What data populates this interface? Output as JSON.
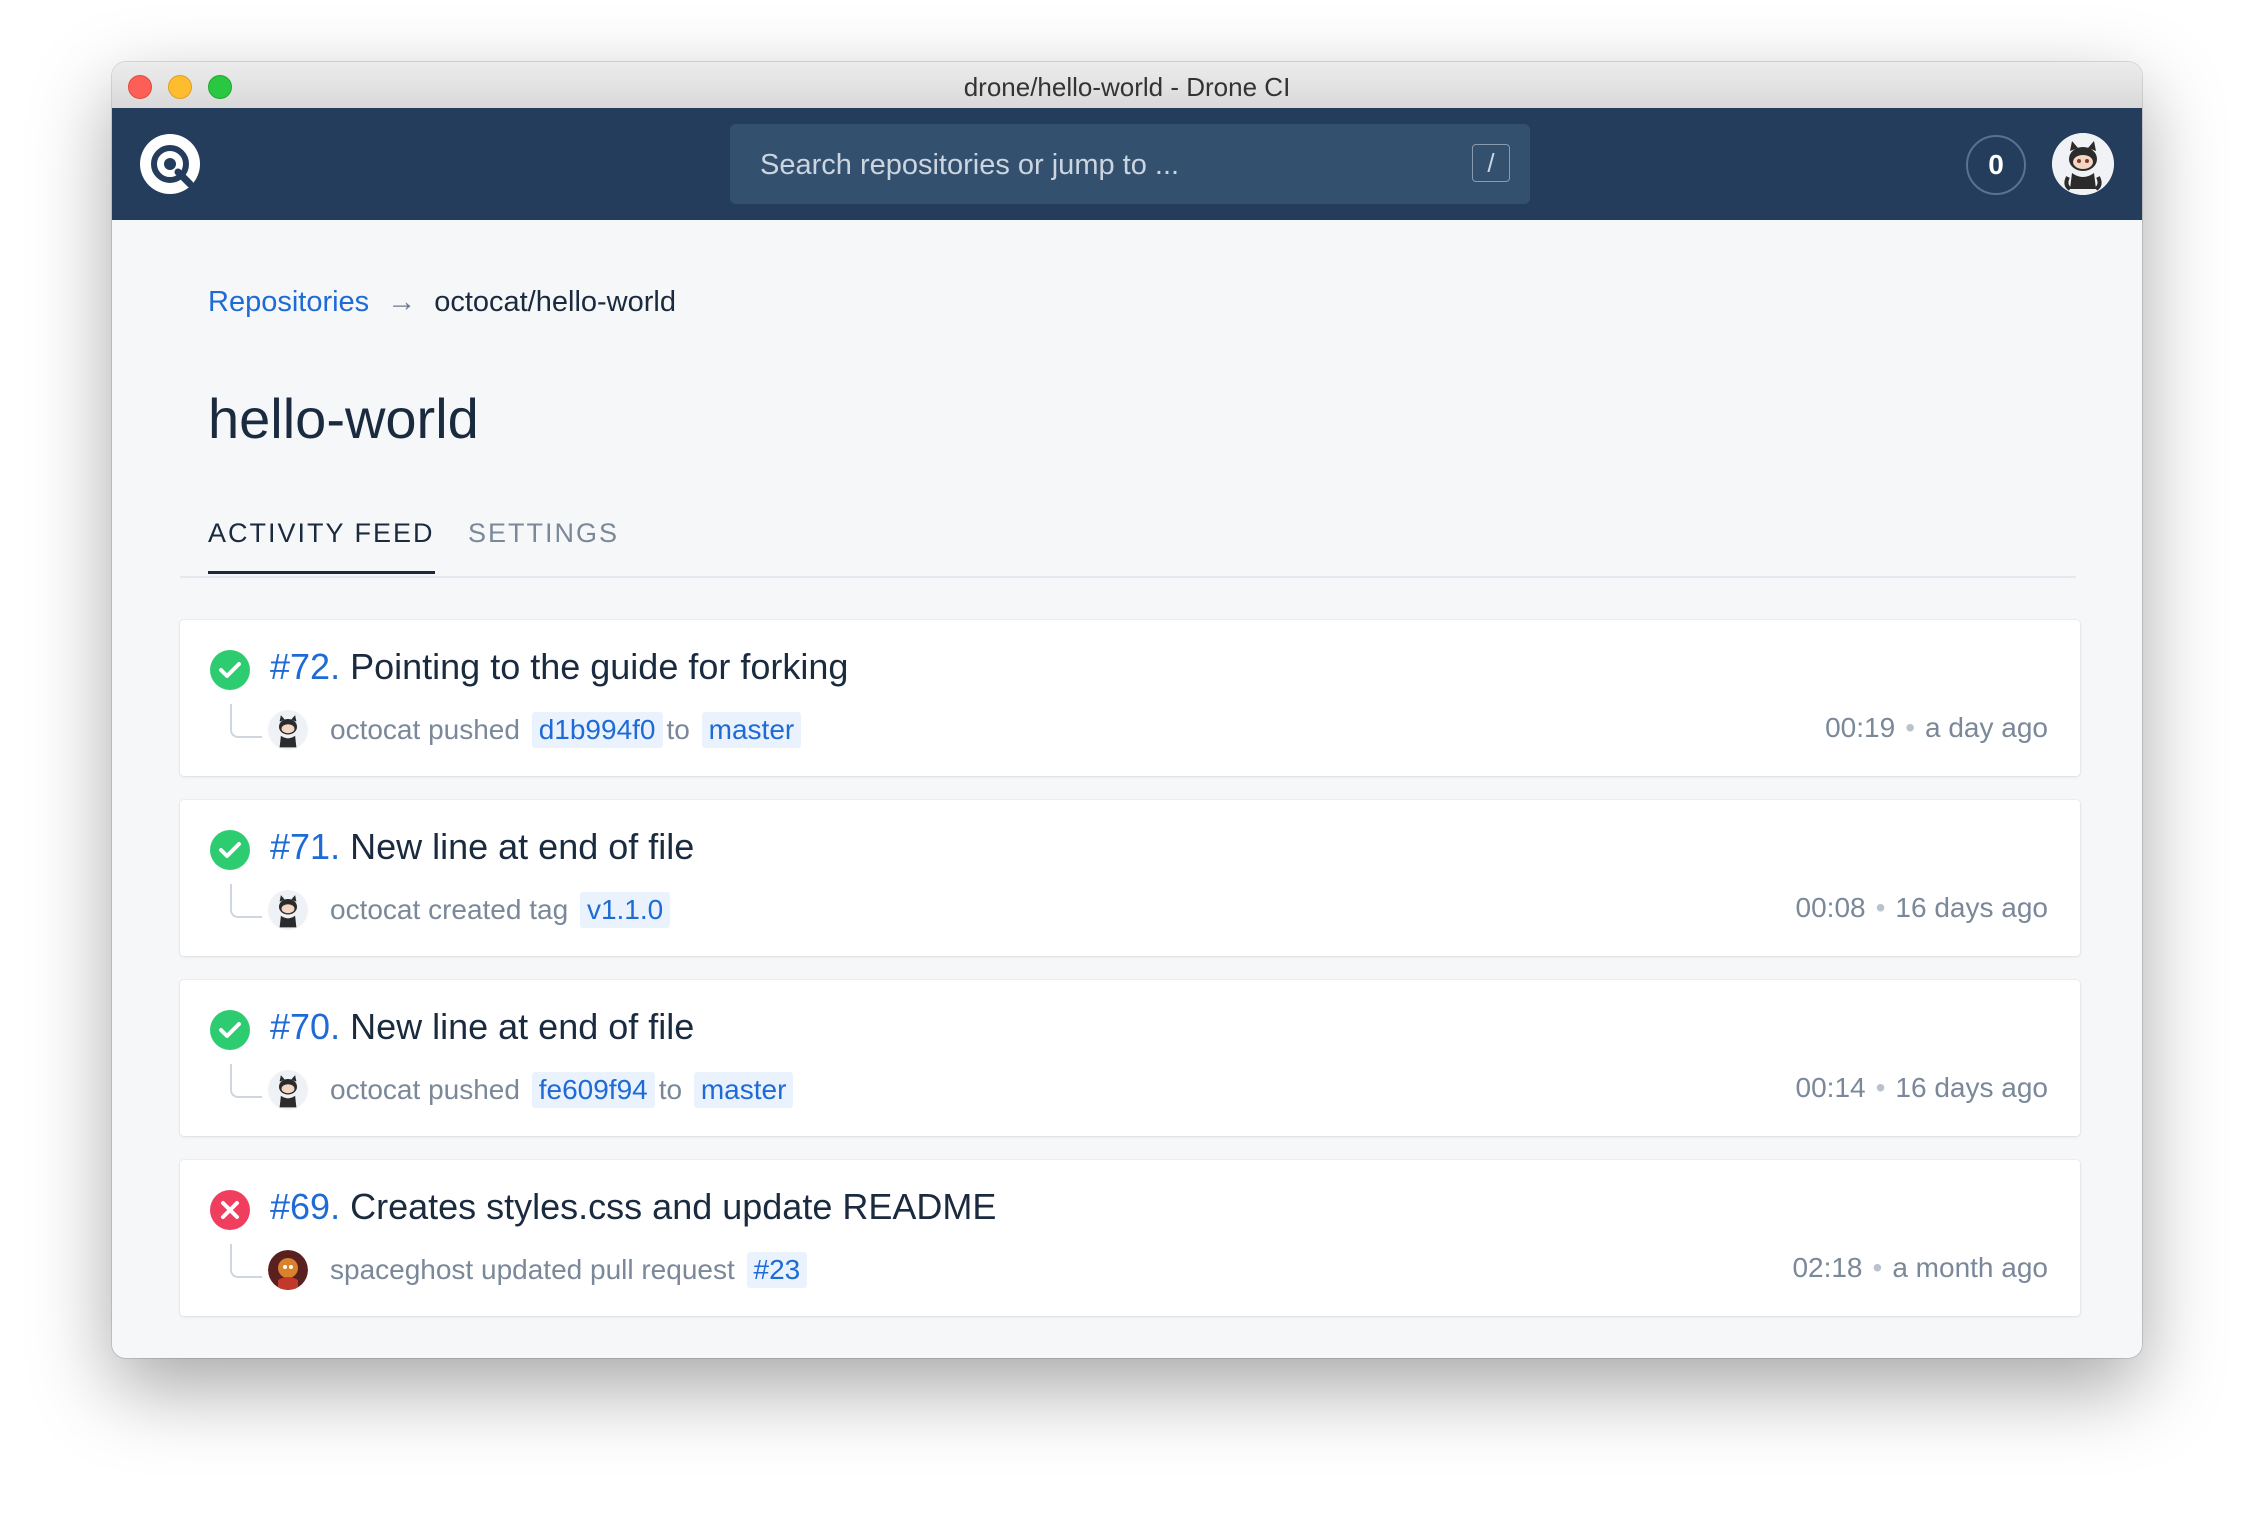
{
  "window": {
    "title": "drone/hello-world - Drone CI"
  },
  "navbar": {
    "search_placeholder": "Search repositories or jump to ...",
    "search_shortcut": "/",
    "notification_count": "0"
  },
  "breadcrumb": {
    "root_label": "Repositories",
    "arrow": "→",
    "current": "octocat/hello-world"
  },
  "page": {
    "title": "hello-world"
  },
  "tabs": [
    {
      "label": "ACTIVITY FEED",
      "active": true
    },
    {
      "label": "SETTINGS",
      "active": false
    }
  ],
  "builds": [
    {
      "number": "#72.",
      "title": "Pointing to the guide for forking",
      "status": "success",
      "author": "octocat",
      "action": "pushed",
      "ref": "d1b994f0",
      "joiner": "to",
      "target": "master",
      "duration": "00:19",
      "time_ago": "a day ago"
    },
    {
      "number": "#71.",
      "title": "New line at end of file",
      "status": "success",
      "author": "octocat",
      "action": "created tag",
      "ref": "v1.1.0",
      "joiner": "",
      "target": "",
      "duration": "00:08",
      "time_ago": "16 days ago"
    },
    {
      "number": "#70.",
      "title": "New line at end of file",
      "status": "success",
      "author": "octocat",
      "action": "pushed",
      "ref": "fe609f94",
      "joiner": "to",
      "target": "master",
      "duration": "00:14",
      "time_ago": "16 days ago"
    },
    {
      "number": "#69.",
      "title": "Creates styles.css and update README",
      "status": "failure",
      "author": "spaceghost",
      "action": "updated pull request",
      "ref": "#23",
      "joiner": "",
      "target": "",
      "duration": "02:18",
      "time_ago": "a month ago"
    }
  ],
  "colors": {
    "navbar": "#243d5c",
    "accent": "#1e6bd6",
    "success": "#2ecc71",
    "failure": "#f03e5f"
  },
  "icons": {
    "logo": "drone-logo-icon",
    "success": "check-circle-icon",
    "failure": "x-circle-icon"
  }
}
